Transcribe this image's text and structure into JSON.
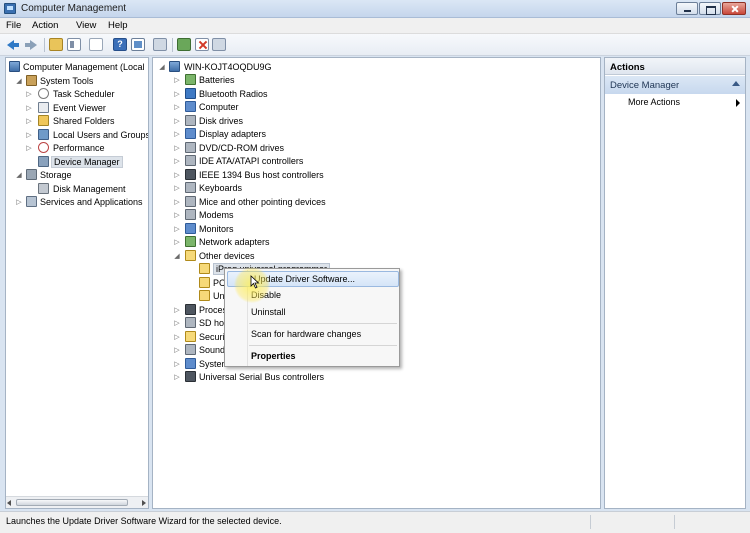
{
  "window": {
    "title": "Computer Management"
  },
  "menu": [
    "File",
    "Action",
    "View",
    "Help"
  ],
  "toolbar": {
    "icons": [
      "back-icon",
      "forward-icon",
      "up-folder-icon",
      "show-hide-tree-icon",
      "export-list-icon",
      "help-icon",
      "view-icon",
      "devices-icon",
      "update-driver-icon",
      "uninstall-icon",
      "scan-hardware-icon"
    ]
  },
  "left_tree": {
    "root": "Computer Management (Local",
    "items": [
      {
        "label": "System Tools"
      },
      {
        "label": "Task Scheduler"
      },
      {
        "label": "Event Viewer"
      },
      {
        "label": "Shared Folders"
      },
      {
        "label": "Local Users and Groups"
      },
      {
        "label": "Performance"
      },
      {
        "label": "Device Manager"
      },
      {
        "label": "Storage"
      },
      {
        "label": "Disk Management"
      },
      {
        "label": "Services and Applications"
      }
    ]
  },
  "device_tree": {
    "root": "WIN-KOJT4OQDU9G",
    "items": [
      {
        "label": "Batteries"
      },
      {
        "label": "Bluetooth Radios"
      },
      {
        "label": "Computer"
      },
      {
        "label": "Disk drives"
      },
      {
        "label": "Display adapters"
      },
      {
        "label": "DVD/CD-ROM drives"
      },
      {
        "label": "IDE ATA/ATAPI controllers"
      },
      {
        "label": "IEEE 1394 Bus host controllers"
      },
      {
        "label": "Keyboards"
      },
      {
        "label": "Mice and other pointing devices"
      },
      {
        "label": "Modems"
      },
      {
        "label": "Monitors"
      },
      {
        "label": "Network adapters"
      },
      {
        "label": "Other devices"
      },
      {
        "label": "iProg universal programmer"
      },
      {
        "label": "PC"
      },
      {
        "label": "Un"
      },
      {
        "label": "Proces"
      },
      {
        "label": "SD hos"
      },
      {
        "label": "Securit"
      },
      {
        "label": "Sound"
      },
      {
        "label": "Syster"
      },
      {
        "label": "Universal Serial Bus controllers"
      }
    ]
  },
  "context_menu": {
    "items": [
      "Update Driver Software...",
      "Disable",
      "Uninstall",
      "Scan for hardware changes",
      "Properties"
    ]
  },
  "actions": {
    "header": "Actions",
    "section": "Device Manager",
    "more": "More Actions"
  },
  "status": "Launches the Update Driver Software Wizard for the selected device."
}
